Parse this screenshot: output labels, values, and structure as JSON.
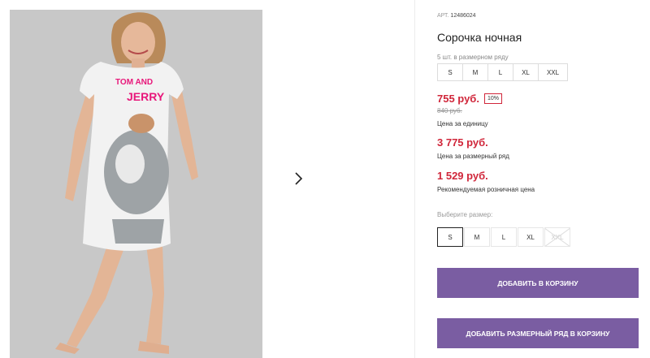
{
  "product": {
    "sku_label": "АРТ.",
    "sku": "12486024",
    "title": "Сорочка ночная",
    "pack_note": "5 шт. в размерном ряду",
    "pack_sizes": [
      "S",
      "M",
      "L",
      "XL",
      "XXL"
    ],
    "price": "755 руб.",
    "discount": "10%",
    "old_price": "840 руб.",
    "price_caption": "Цена за единицу",
    "pack_price": "3 775 руб.",
    "pack_price_caption": "Цена за размерный ряд",
    "retail_price": "1 529 руб.",
    "retail_caption": "Рекомендуемая розничная цена",
    "choose_label": "Выберите размер:",
    "sizes": [
      {
        "label": "S",
        "state": "selected"
      },
      {
        "label": "M",
        "state": "available"
      },
      {
        "label": "L",
        "state": "available"
      },
      {
        "label": "XL",
        "state": "available"
      },
      {
        "label": "XXL",
        "state": "unavailable"
      }
    ],
    "add_to_cart": "ДОБАВИТЬ В КОРЗИНУ",
    "add_pack_to_cart": "ДОБАВИТЬ РАЗМЕРНЫЙ РЯД В КОРЗИНУ"
  },
  "shirt_print": {
    "line1": "TOM AND",
    "line2": "JERRY"
  },
  "colors": {
    "price": "#d0263a",
    "button": "#7a5da2",
    "photo_bg": "#c9c9c9",
    "print": "#e8177a"
  },
  "icons": {
    "next": "chevron-right-icon"
  }
}
